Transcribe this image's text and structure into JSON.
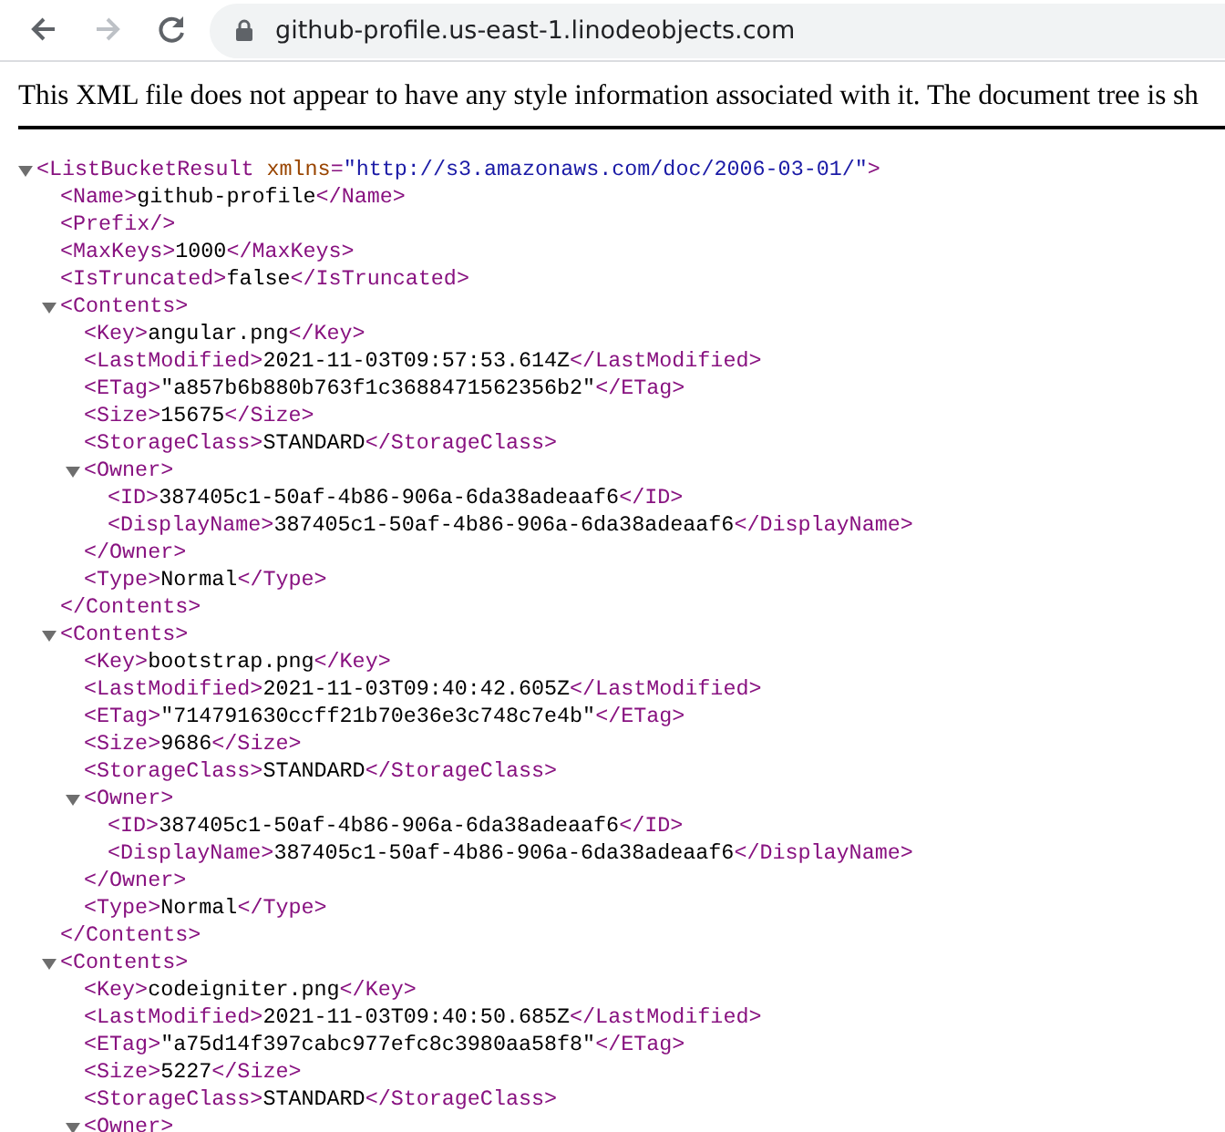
{
  "toolbar": {
    "nav_buttons": [
      {
        "kind": "back",
        "disabled": false
      },
      {
        "kind": "forward",
        "disabled": true
      },
      {
        "kind": "reload",
        "disabled": false
      }
    ],
    "address": {
      "url": "github-profile.us-east-1.linodeobjects.com",
      "secure": true
    }
  },
  "notice": "This XML file does not appear to have any style information associated with it. The document tree is sh",
  "tree": [
    {
      "kind": "element",
      "expanded": true,
      "parts": [
        {
          "kind": "tag",
          "text": "<ListBucketResult"
        },
        {
          "kind": "attr_name",
          "text": "xmlns"
        },
        {
          "kind": "tag",
          "text": "="
        },
        {
          "kind": "attr_value",
          "text": "\"http://s3.amazonaws.com/doc/2006-03-01/\""
        },
        {
          "kind": "tag",
          "text": ">"
        }
      ],
      "children": [
        {
          "kind": "leaf",
          "parts": [
            {
              "kind": "tag",
              "text": "<Name>"
            },
            {
              "kind": "text",
              "text": "github-profile"
            },
            {
              "kind": "tag",
              "text": "</Name>"
            }
          ]
        },
        {
          "kind": "leaf",
          "parts": [
            {
              "kind": "tag",
              "text": "<Prefix/>"
            }
          ]
        },
        {
          "kind": "leaf",
          "parts": [
            {
              "kind": "tag",
              "text": "<MaxKeys>"
            },
            {
              "kind": "text",
              "text": "1000"
            },
            {
              "kind": "tag",
              "text": "</MaxKeys>"
            }
          ]
        },
        {
          "kind": "leaf",
          "parts": [
            {
              "kind": "tag",
              "text": "<IsTruncated>"
            },
            {
              "kind": "text",
              "text": "false"
            },
            {
              "kind": "tag",
              "text": "</IsTruncated>"
            }
          ]
        },
        {
          "kind": "element",
          "expanded": true,
          "parts": [
            {
              "kind": "tag",
              "text": "<Contents>"
            }
          ],
          "children": [
            {
              "kind": "leaf",
              "parts": [
                {
                  "kind": "tag",
                  "text": "<Key>"
                },
                {
                  "kind": "text",
                  "text": "angular.png"
                },
                {
                  "kind": "tag",
                  "text": "</Key>"
                }
              ]
            },
            {
              "kind": "leaf",
              "parts": [
                {
                  "kind": "tag",
                  "text": "<LastModified>"
                },
                {
                  "kind": "text",
                  "text": "2021-11-03T09:57:53.614Z"
                },
                {
                  "kind": "tag",
                  "text": "</LastModified>"
                }
              ]
            },
            {
              "kind": "leaf",
              "parts": [
                {
                  "kind": "tag",
                  "text": "<ETag>"
                },
                {
                  "kind": "text",
                  "text": "\"a857b6b880b763f1c3688471562356b2\""
                },
                {
                  "kind": "tag",
                  "text": "</ETag>"
                }
              ]
            },
            {
              "kind": "leaf",
              "parts": [
                {
                  "kind": "tag",
                  "text": "<Size>"
                },
                {
                  "kind": "text",
                  "text": "15675"
                },
                {
                  "kind": "tag",
                  "text": "</Size>"
                }
              ]
            },
            {
              "kind": "leaf",
              "parts": [
                {
                  "kind": "tag",
                  "text": "<StorageClass>"
                },
                {
                  "kind": "text",
                  "text": "STANDARD"
                },
                {
                  "kind": "tag",
                  "text": "</StorageClass>"
                }
              ]
            },
            {
              "kind": "element",
              "expanded": true,
              "parts": [
                {
                  "kind": "tag",
                  "text": "<Owner>"
                }
              ],
              "children": [
                {
                  "kind": "leaf",
                  "parts": [
                    {
                      "kind": "tag",
                      "text": "<ID>"
                    },
                    {
                      "kind": "text",
                      "text": "387405c1-50af-4b86-906a-6da38adeaaf6"
                    },
                    {
                      "kind": "tag",
                      "text": "</ID>"
                    }
                  ]
                },
                {
                  "kind": "leaf",
                  "parts": [
                    {
                      "kind": "tag",
                      "text": "<DisplayName>"
                    },
                    {
                      "kind": "text",
                      "text": "387405c1-50af-4b86-906a-6da38adeaaf6"
                    },
                    {
                      "kind": "tag",
                      "text": "</DisplayName>"
                    }
                  ]
                }
              ],
              "closing": [
                {
                  "kind": "tag",
                  "text": "</Owner>"
                }
              ]
            },
            {
              "kind": "leaf",
              "parts": [
                {
                  "kind": "tag",
                  "text": "<Type>"
                },
                {
                  "kind": "text",
                  "text": "Normal"
                },
                {
                  "kind": "tag",
                  "text": "</Type>"
                }
              ]
            }
          ],
          "closing": [
            {
              "kind": "tag",
              "text": "</Contents>"
            }
          ]
        },
        {
          "kind": "element",
          "expanded": true,
          "parts": [
            {
              "kind": "tag",
              "text": "<Contents>"
            }
          ],
          "children": [
            {
              "kind": "leaf",
              "parts": [
                {
                  "kind": "tag",
                  "text": "<Key>"
                },
                {
                  "kind": "text",
                  "text": "bootstrap.png"
                },
                {
                  "kind": "tag",
                  "text": "</Key>"
                }
              ]
            },
            {
              "kind": "leaf",
              "parts": [
                {
                  "kind": "tag",
                  "text": "<LastModified>"
                },
                {
                  "kind": "text",
                  "text": "2021-11-03T09:40:42.605Z"
                },
                {
                  "kind": "tag",
                  "text": "</LastModified>"
                }
              ]
            },
            {
              "kind": "leaf",
              "parts": [
                {
                  "kind": "tag",
                  "text": "<ETag>"
                },
                {
                  "kind": "text",
                  "text": "\"714791630ccff21b70e36e3c748c7e4b\""
                },
                {
                  "kind": "tag",
                  "text": "</ETag>"
                }
              ]
            },
            {
              "kind": "leaf",
              "parts": [
                {
                  "kind": "tag",
                  "text": "<Size>"
                },
                {
                  "kind": "text",
                  "text": "9686"
                },
                {
                  "kind": "tag",
                  "text": "</Size>"
                }
              ]
            },
            {
              "kind": "leaf",
              "parts": [
                {
                  "kind": "tag",
                  "text": "<StorageClass>"
                },
                {
                  "kind": "text",
                  "text": "STANDARD"
                },
                {
                  "kind": "tag",
                  "text": "</StorageClass>"
                }
              ]
            },
            {
              "kind": "element",
              "expanded": true,
              "parts": [
                {
                  "kind": "tag",
                  "text": "<Owner>"
                }
              ],
              "children": [
                {
                  "kind": "leaf",
                  "parts": [
                    {
                      "kind": "tag",
                      "text": "<ID>"
                    },
                    {
                      "kind": "text",
                      "text": "387405c1-50af-4b86-906a-6da38adeaaf6"
                    },
                    {
                      "kind": "tag",
                      "text": "</ID>"
                    }
                  ]
                },
                {
                  "kind": "leaf",
                  "parts": [
                    {
                      "kind": "tag",
                      "text": "<DisplayName>"
                    },
                    {
                      "kind": "text",
                      "text": "387405c1-50af-4b86-906a-6da38adeaaf6"
                    },
                    {
                      "kind": "tag",
                      "text": "</DisplayName>"
                    }
                  ]
                }
              ],
              "closing": [
                {
                  "kind": "tag",
                  "text": "</Owner>"
                }
              ]
            },
            {
              "kind": "leaf",
              "parts": [
                {
                  "kind": "tag",
                  "text": "<Type>"
                },
                {
                  "kind": "text",
                  "text": "Normal"
                },
                {
                  "kind": "tag",
                  "text": "</Type>"
                }
              ]
            }
          ],
          "closing": [
            {
              "kind": "tag",
              "text": "</Contents>"
            }
          ]
        },
        {
          "kind": "element",
          "expanded": true,
          "parts": [
            {
              "kind": "tag",
              "text": "<Contents>"
            }
          ],
          "children": [
            {
              "kind": "leaf",
              "parts": [
                {
                  "kind": "tag",
                  "text": "<Key>"
                },
                {
                  "kind": "text",
                  "text": "codeigniter.png"
                },
                {
                  "kind": "tag",
                  "text": "</Key>"
                }
              ]
            },
            {
              "kind": "leaf",
              "parts": [
                {
                  "kind": "tag",
                  "text": "<LastModified>"
                },
                {
                  "kind": "text",
                  "text": "2021-11-03T09:40:50.685Z"
                },
                {
                  "kind": "tag",
                  "text": "</LastModified>"
                }
              ]
            },
            {
              "kind": "leaf",
              "parts": [
                {
                  "kind": "tag",
                  "text": "<ETag>"
                },
                {
                  "kind": "text",
                  "text": "\"a75d14f397cabc977efc8c3980aa58f8\""
                },
                {
                  "kind": "tag",
                  "text": "</ETag>"
                }
              ]
            },
            {
              "kind": "leaf",
              "parts": [
                {
                  "kind": "tag",
                  "text": "<Size>"
                },
                {
                  "kind": "text",
                  "text": "5227"
                },
                {
                  "kind": "tag",
                  "text": "</Size>"
                }
              ]
            },
            {
              "kind": "leaf",
              "parts": [
                {
                  "kind": "tag",
                  "text": "<StorageClass>"
                },
                {
                  "kind": "text",
                  "text": "STANDARD"
                },
                {
                  "kind": "tag",
                  "text": "</StorageClass>"
                }
              ]
            },
            {
              "kind": "element",
              "expanded": true,
              "parts": [
                {
                  "kind": "tag",
                  "text": "<Owner>"
                }
              ]
            }
          ]
        }
      ]
    }
  ]
}
